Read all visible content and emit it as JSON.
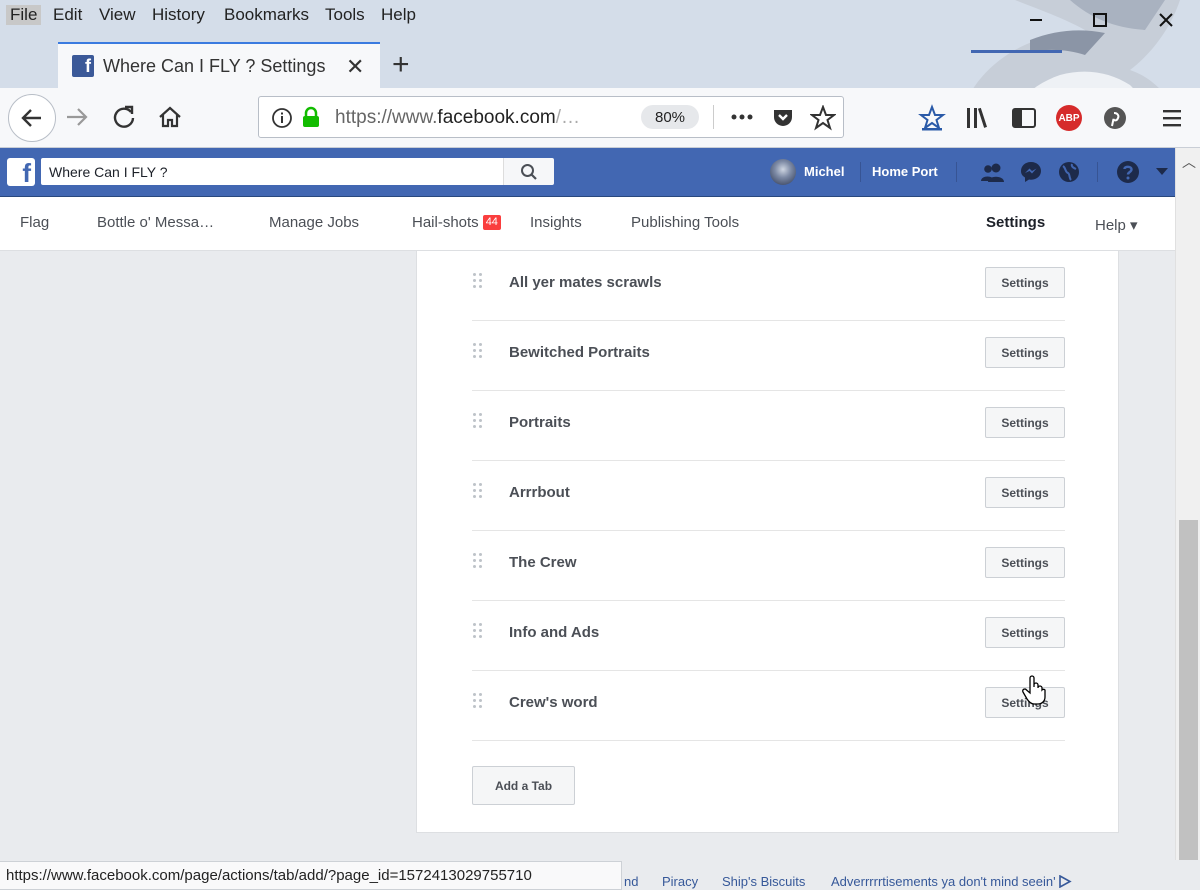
{
  "browser": {
    "menu": [
      "File",
      "Edit",
      "View",
      "History",
      "Bookmarks",
      "Tools",
      "Help"
    ],
    "tab_title": "Where Can I FLY ? Settings",
    "url_prefix": "https://www.",
    "url_domain": "facebook.com",
    "url_suffix": "/…",
    "zoom": "80%",
    "adblock_label": "ABP",
    "status_url": "https://www.facebook.com/page/actions/tab/add/?page_id=1572413029755710"
  },
  "fb_header": {
    "search_value": "Where Can I FLY ?",
    "username": "Michel",
    "home_label": "Home Port"
  },
  "page_nav": {
    "flag": "Flag",
    "bottle": "Bottle o' Messa…",
    "manage_jobs": "Manage Jobs",
    "hailshots": "Hail-shots",
    "hailshots_badge": "44",
    "insights": "Insights",
    "publishing_tools": "Publishing Tools",
    "settings": "Settings",
    "help": "Help ▾"
  },
  "tabs": [
    {
      "label": "All yer mates scrawls",
      "button": "Settings"
    },
    {
      "label": "Bewitched Portraits",
      "button": "Settings"
    },
    {
      "label": "Portraits",
      "button": "Settings"
    },
    {
      "label": "Arrrbout",
      "button": "Settings"
    },
    {
      "label": "The Crew",
      "button": "Settings"
    },
    {
      "label": "Info and Ads",
      "button": "Settings"
    },
    {
      "label": "Crew's word",
      "button": "Settings"
    }
  ],
  "add_tab_label": "Add a Tab",
  "footer": {
    "partial": "nd",
    "piracy": "Piracy",
    "biscuits": "Ship's Biscuits",
    "ads": "Adverrrrrtisements ya don't mind seein'"
  },
  "colors": {
    "fb_blue": "#4267b2",
    "badge_red": "#fa3e3e",
    "link_blue": "#365899"
  }
}
